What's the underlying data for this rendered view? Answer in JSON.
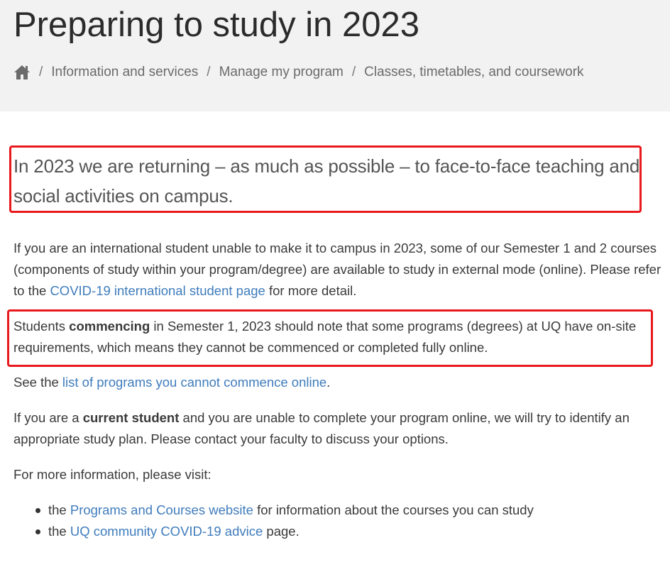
{
  "header": {
    "title": "Preparing to study in 2023",
    "breadcrumb": {
      "home_icon": "home-icon",
      "separator": "/",
      "items": [
        "Information and services",
        "Manage my program",
        "Classes, timetables, and coursework"
      ]
    }
  },
  "main": {
    "lead": "In 2023 we are returning – as much as possible – to face-to-face teaching and social activities on campus.",
    "para1": {
      "text_before": "If you are an international student unable to make it to campus in 2023, some of our Semester 1 and 2 courses (components of study within your program/degree) are available to study in external mode (online). Please refer to the ",
      "link": "COVID-19 international student page",
      "text_after": " for more detail."
    },
    "para2": {
      "text_before": "Students ",
      "bold": "commencing",
      "text_after": " in Semester 1, 2023 should note that some programs (degrees) at UQ have on-site requirements, which means they cannot be commenced or completed fully online."
    },
    "para3": {
      "text_before": "See the ",
      "link": "list of programs you cannot commence online",
      "text_after": "."
    },
    "para4": {
      "text_before": "If you are a ",
      "bold": "current student",
      "text_after": " and you are unable to complete your program online, we will try to identify an appropriate study plan. Please contact your faculty to discuss your options."
    },
    "para5": "For more information, please visit:",
    "list": [
      {
        "before": "the ",
        "link": "Programs and Courses website",
        "after": " for information about the courses you can study"
      },
      {
        "before": "the ",
        "link": "UQ community COVID-19 advice",
        "after": " page."
      }
    ]
  },
  "colors": {
    "header_bg": "#f2f2f2",
    "link": "#3f7cbc",
    "highlight_box": "#e8181c"
  }
}
